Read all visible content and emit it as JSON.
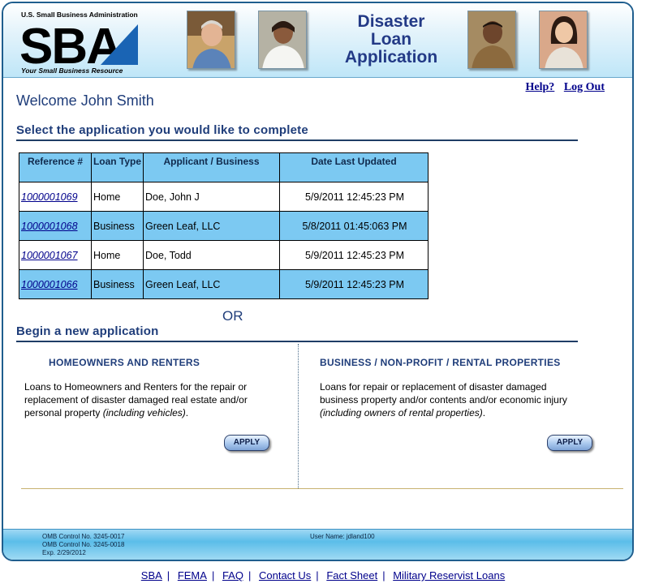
{
  "header": {
    "agency": "U.S. Small Business Administration",
    "logo_text": "SBA",
    "tagline": "Your Small Business Resource",
    "banner_title_lines": [
      "Disaster",
      "Loan",
      "Application"
    ]
  },
  "top_links": {
    "help": "Help?",
    "logout": "Log Out"
  },
  "welcome": "Welcome John Smith",
  "select_section": {
    "title": "Select the application you would like to complete",
    "columns": [
      "Reference #",
      "Loan Type",
      "Applicant / Business",
      "Date Last Updated"
    ],
    "rows": [
      {
        "ref": "1000001069",
        "type": "Home",
        "applicant": "Doe, John J",
        "date": "5/9/2011  12:45:23 PM"
      },
      {
        "ref": "1000001068",
        "type": "Business",
        "applicant": "Green Leaf, LLC",
        "date": "5/8/2011  01:45:063 PM"
      },
      {
        "ref": "1000001067",
        "type": "Home",
        "applicant": "Doe, Todd",
        "date": "5/9/2011  12:45:23 PM"
      },
      {
        "ref": "1000001066",
        "type": "Business",
        "applicant": "Green Leaf, LLC",
        "date": "5/9/2011  12:45:23 PM"
      }
    ]
  },
  "or_label": "OR",
  "new_section": {
    "title": "Begin a new application",
    "homeowners": {
      "heading": "HOMEOWNERS AND RENTERS",
      "description": "Loans to Homeowners and Renters for the repair or replacement of disaster damaged real estate and/or personal property ",
      "description_italic": "(including vehicles)",
      "description_end": ".",
      "button": "APPLY"
    },
    "business": {
      "heading": "BUSINESS / NON-PROFIT / RENTAL PROPERTIES",
      "description": "Loans for repair or replacement of disaster damaged business property and/or contents and/or economic injury ",
      "description_italic": "(including owners of rental properties)",
      "description_end": ".",
      "button": "APPLY"
    }
  },
  "footer": {
    "omb_lines": [
      "OMB Control No. 3245-0017",
      "OMB Control No. 3245-0018",
      "Exp. 2/29/2012"
    ],
    "user_name": "User Name: jdland100"
  },
  "bottom_nav": [
    "SBA",
    "FEMA",
    "FAQ",
    "Contact Us",
    "Fact Sheet",
    "Military Reservist Loans"
  ],
  "colors": {
    "table_header": "#7cc9f2",
    "heading_text": "#1f3d7a",
    "link": "#00008b",
    "frame_border": "#1f5e8e"
  }
}
